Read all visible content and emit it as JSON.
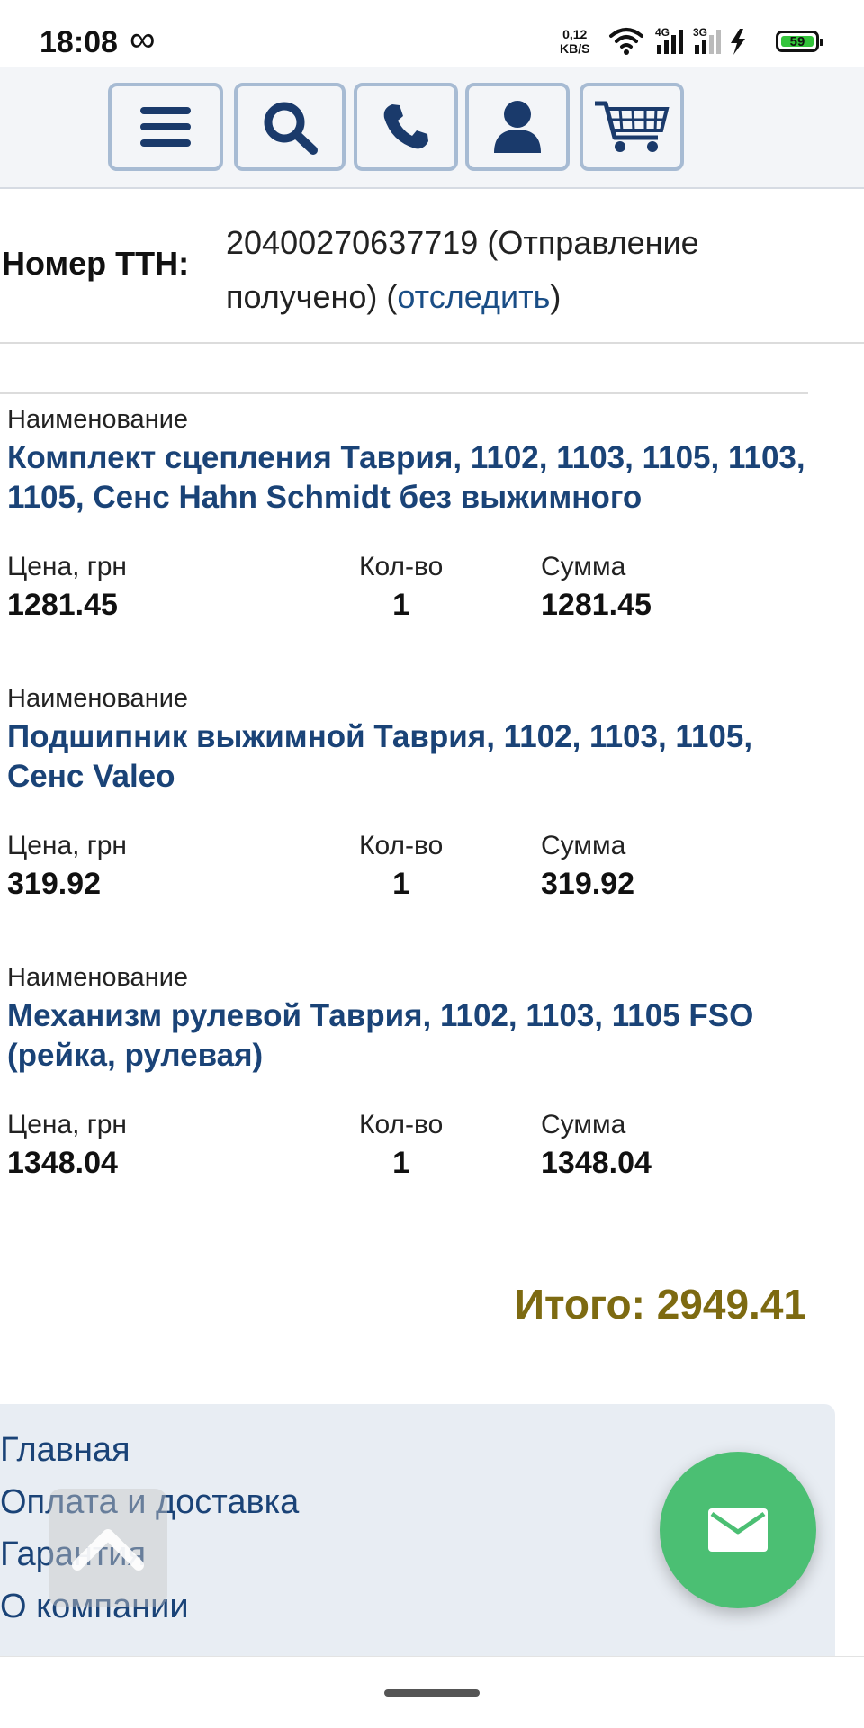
{
  "status_bar": {
    "time": "18:08",
    "speed_value": "0,12",
    "speed_unit": "KB/S",
    "net1": "4G",
    "net2": "3G",
    "battery": "59"
  },
  "nav": {
    "icons": [
      "menu-icon",
      "search-icon",
      "phone-icon",
      "user-icon",
      "cart-icon"
    ],
    "icon_color": "#1a3a6b"
  },
  "ttn": {
    "label": "Номер ТТН:",
    "number": "20400270637719",
    "status": "(Отправление получено)",
    "paren_open": "(",
    "link": "отследить",
    "paren_close": ")"
  },
  "items": [
    {
      "name_label": "Наименование",
      "name": "Комплект сцепления Таврия, 1102, 1103, 1105, 1103, 1105, Сенс Hahn Schmidt без выжимного",
      "price_label": "Цена, грн",
      "price": "1281.45",
      "qty_label": "Кол-во",
      "qty": "1",
      "sum_label": "Сумма",
      "sum": "1281.45"
    },
    {
      "name_label": "Наименование",
      "name": "Подшипник выжимной Таврия, 1102, 1103, 1105, Сенс Valeo",
      "price_label": "Цена, грн",
      "price": "319.92",
      "qty_label": "Кол-во",
      "qty": "1",
      "sum_label": "Сумма",
      "sum": "319.92"
    },
    {
      "name_label": "Наименование",
      "name": "Механизм рулевой Таврия, 1102, 1103, 1105 FSO (рейка, рулевая)",
      "price_label": "Цена, грн",
      "price": "1348.04",
      "qty_label": "Кол-во",
      "qty": "1",
      "sum_label": "Сумма",
      "sum": "1348.04"
    }
  ],
  "total": "Итого: 2949.41",
  "footer": {
    "links": [
      "Главная",
      "Оплата и доставка",
      "Гарантия",
      "О компании"
    ]
  },
  "colors": {
    "link": "#1a4377",
    "total": "#7d6a11",
    "fab": "#4bbf73"
  }
}
